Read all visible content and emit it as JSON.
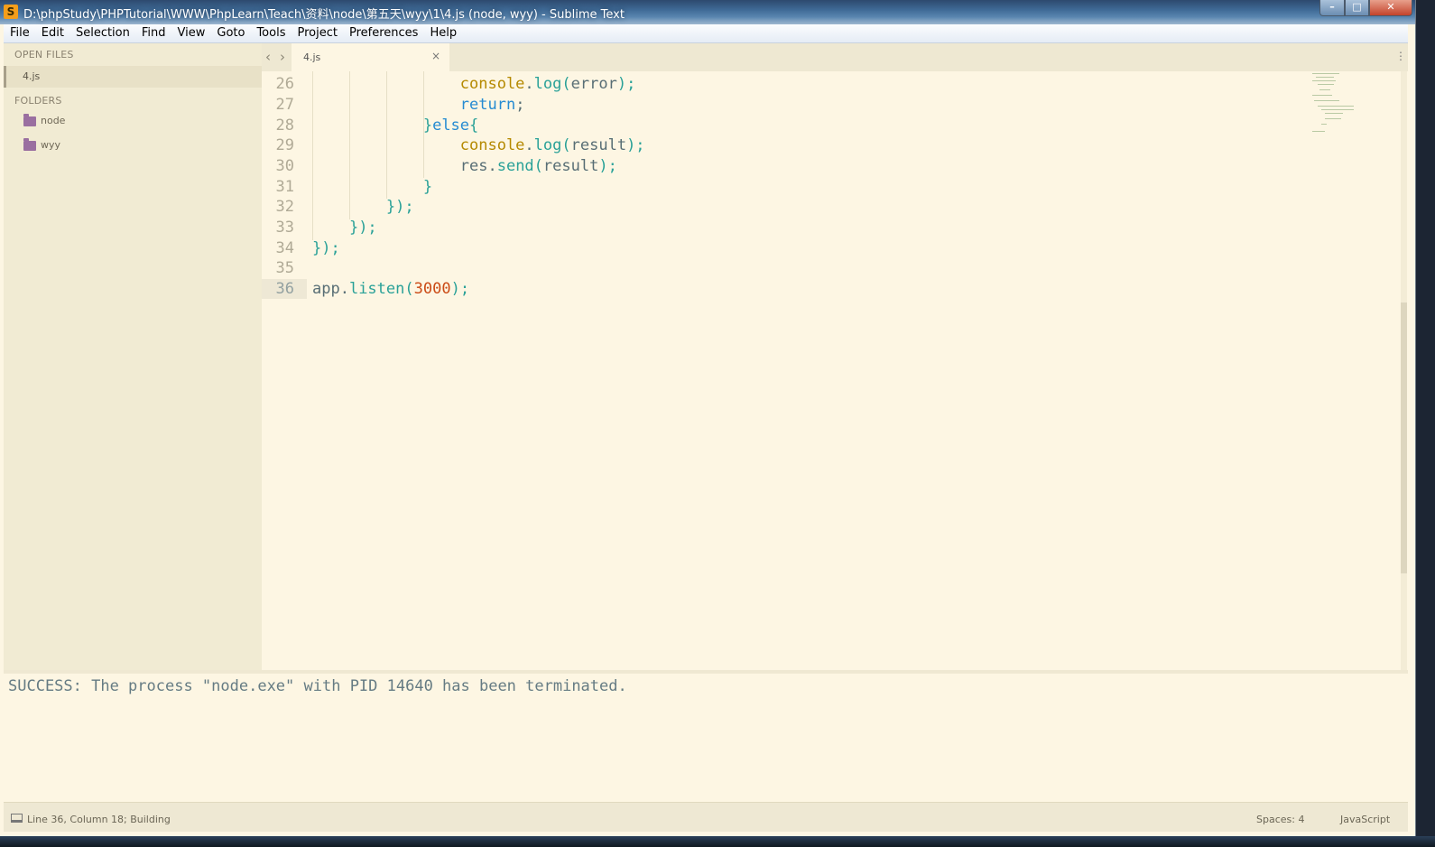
{
  "window": {
    "title": "D:\\phpStudy\\PHPTutorial\\WWW\\PhpLearn\\Teach\\资料\\node\\第五天\\wyy\\1\\4.js (node, wyy) - Sublime Text",
    "app_icon_glyph": "S",
    "minimize": "–",
    "maximize": "□",
    "close": "✕"
  },
  "menu": [
    "File",
    "Edit",
    "Selection",
    "Find",
    "View",
    "Goto",
    "Tools",
    "Project",
    "Preferences",
    "Help"
  ],
  "sidebar": {
    "open_files_header": "OPEN FILES",
    "open_files": [
      "4.js"
    ],
    "folders_header": "FOLDERS",
    "folders": [
      "node",
      "wyy"
    ]
  },
  "tabs": {
    "prev": "‹",
    "next": "›",
    "active_tab": "4.js",
    "close_glyph": "×",
    "overflow_glyph": "⋮"
  },
  "editor": {
    "line_numbers": [
      "26",
      "27",
      "28",
      "29",
      "30",
      "31",
      "32",
      "33",
      "34",
      "35",
      "36"
    ],
    "current_line": "36"
  },
  "output": {
    "text": "SUCCESS: The process \"node.exe\" with PID 14640 has been terminated."
  },
  "status": {
    "position": "Line 36, Column 18; Building",
    "indent": "Spaces: 4",
    "syntax": "JavaScript"
  },
  "colors": {
    "background": "#fdf6e3",
    "sidebar": "#f1ebd3",
    "keyword": "#268bd2",
    "function": "#2aa198",
    "object": "#b58900",
    "number": "#cb4b16"
  }
}
